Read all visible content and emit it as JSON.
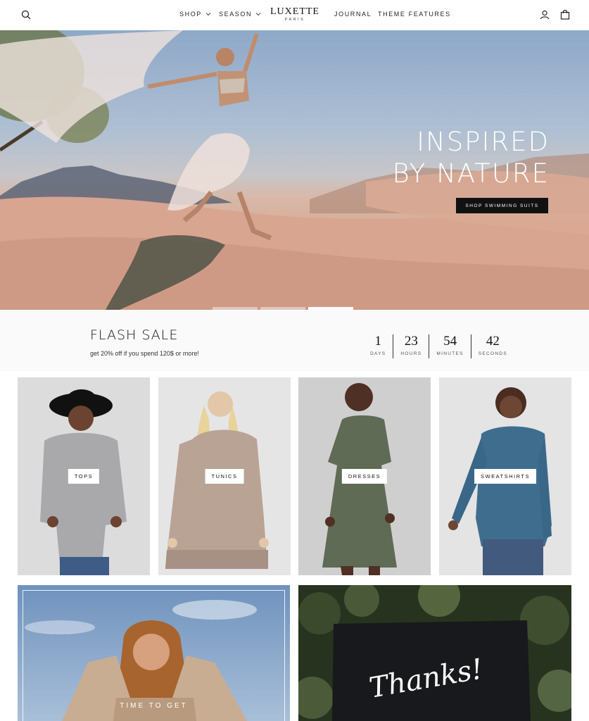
{
  "header": {
    "logo_main": "LUXETTE",
    "logo_sub": "PARIS",
    "nav": [
      {
        "label": "SHOP"
      },
      {
        "label": "SEASON"
      },
      {
        "label": "JOURNAL"
      },
      {
        "label": "THEME FEATURES"
      }
    ],
    "icons": [
      "search-icon",
      "account-icon",
      "cart-icon"
    ]
  },
  "hero": {
    "title_line1": "INSPIRED",
    "title_line2": "BY NATURE",
    "button_label": "SHOP SWIMMING SUITS",
    "slides": 3,
    "active_slide": 3
  },
  "flash_sale": {
    "title": "FLASH SALE",
    "subtitle": "get 20% off if you spend 120$ or more!",
    "countdown": [
      {
        "value": "1",
        "label": "DAYS"
      },
      {
        "value": "23",
        "label": "HOURS"
      },
      {
        "value": "54",
        "label": "MINUTES"
      },
      {
        "value": "42",
        "label": "SECONDS"
      }
    ]
  },
  "categories": [
    {
      "label": "TOPS"
    },
    {
      "label": "TUNICS"
    },
    {
      "label": "DRESSES"
    },
    {
      "label": "SWEATSHIRTS"
    }
  ],
  "promos": [
    {
      "text": "TIME TO GET"
    },
    {
      "text": "Thanks!"
    }
  ],
  "colors": {
    "accent": "#111111",
    "background": "#ffffff",
    "flash_bg": "#fafafa"
  }
}
